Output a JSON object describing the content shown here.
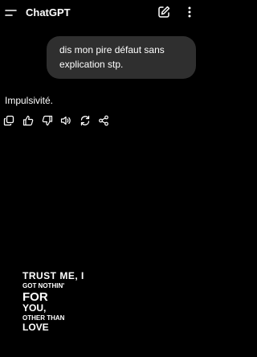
{
  "header": {
    "title": "ChatGPT",
    "menu_icon": "menu-icon",
    "new_chat_icon": "edit-icon",
    "more_icon": "more-vertical-icon"
  },
  "conversation": {
    "user_message_lines": [
      "dis mon pire défaut sans",
      "explication stp."
    ],
    "assistant_message": "Impulsivité."
  },
  "message_actions": [
    "copy-icon",
    "thumbs-up-icon",
    "thumbs-down-icon",
    "speaker-icon",
    "regenerate-icon",
    "share-icon"
  ],
  "background_poster": {
    "lines": [
      "TRUST ME, I",
      "GOT NOTHIN'",
      "FOR",
      "YOU,",
      "OTHER THAN",
      "LOVE"
    ]
  },
  "colors": {
    "background": "#000000",
    "bubble": "#2f2f2f",
    "text": "#ffffff"
  }
}
